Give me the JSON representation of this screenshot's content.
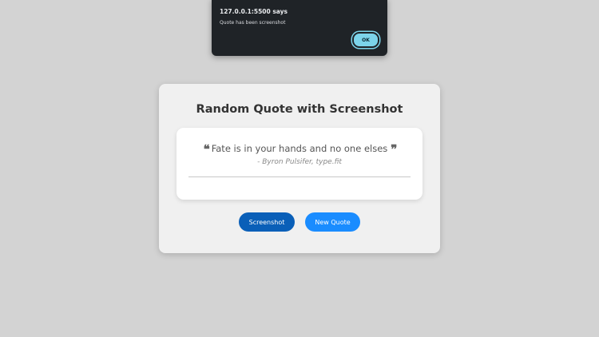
{
  "alert": {
    "title": "127.0.0.1:5500 says",
    "message": "Quote has been screenshot",
    "ok_label": "OK"
  },
  "card": {
    "title": "Random Quote with Screenshot",
    "quote": {
      "open_mark": "❝",
      "text": "Fate is in your hands and no one elses",
      "close_mark": "❞",
      "author": "- Byron Pulsifer, type.fit"
    },
    "buttons": {
      "screenshot_label": "Screenshot",
      "new_quote_label": "New Quote"
    }
  },
  "colors": {
    "background": "#d3d3d3",
    "card": "#f0f0f0",
    "screenshot_button": "#0a5fb8",
    "new_quote_button": "#1a8cff",
    "alert_background": "#1f2327",
    "alert_ok": "#7cd4ea"
  },
  "icons": {
    "open_quote": "quote-left-icon",
    "close_quote": "quote-right-icon"
  }
}
